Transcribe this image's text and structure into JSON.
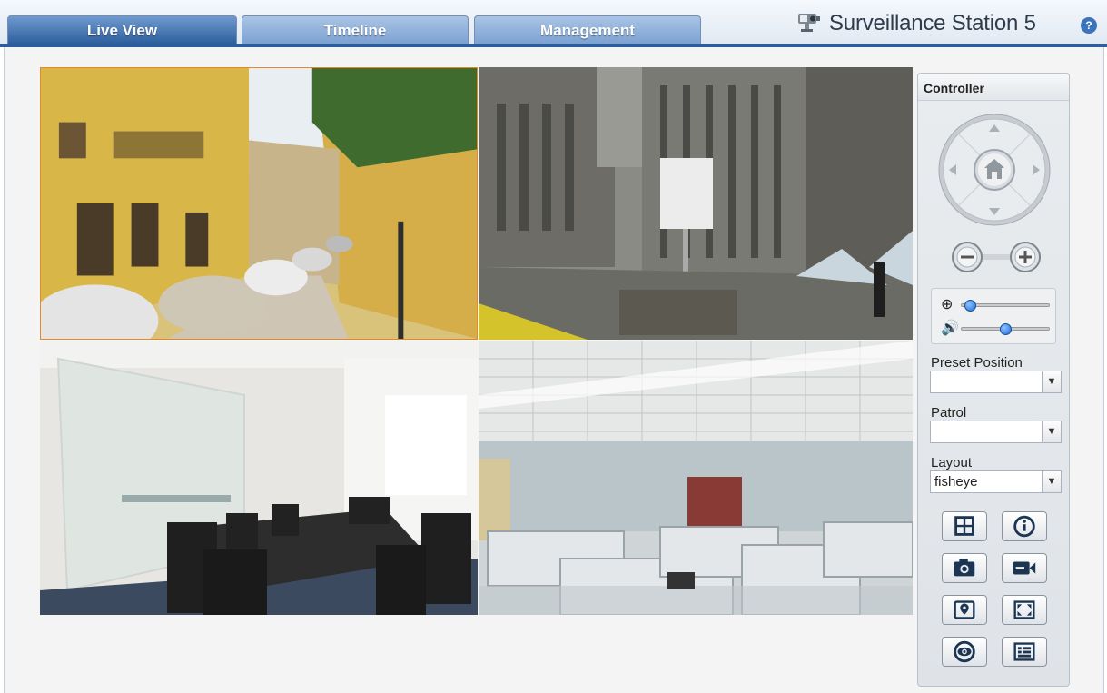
{
  "header": {
    "tabs": [
      {
        "label": "Live View",
        "active": true
      },
      {
        "label": "Timeline",
        "active": false
      },
      {
        "label": "Management",
        "active": false
      }
    ],
    "app_title": "Surveillance Station 5",
    "help_icon": "help-icon",
    "help_symbol": "?"
  },
  "controller": {
    "title": "Controller",
    "dpad_icons": [
      "up-arrow-icon",
      "down-arrow-icon",
      "left-arrow-icon",
      "right-arrow-icon",
      "home-icon"
    ],
    "zoom_buttons": [
      "zoom-out-icon",
      "zoom-in-icon"
    ],
    "zoom_slider_level": 0.05,
    "volume_slider_level": 0.5,
    "preset_position": {
      "label": "Preset Position",
      "value": ""
    },
    "patrol": {
      "label": "Patrol",
      "value": ""
    },
    "layout": {
      "label": "Layout",
      "value": "fisheye"
    },
    "tool_buttons": [
      "layout-grid-icon",
      "info-icon",
      "snapshot-icon",
      "record-icon",
      "emap-icon",
      "fullscreen-icon",
      "eye-icon",
      "list-icon"
    ]
  },
  "views": [
    {
      "name": "camera-view-street"
    },
    {
      "name": "camera-view-plaza"
    },
    {
      "name": "camera-view-meeting-room"
    },
    {
      "name": "camera-view-office"
    }
  ],
  "colors": {
    "tab_active": "#2c5d9c",
    "tab_inactive": "#7ba0d0",
    "slider_knob": "#1f6ad0"
  }
}
